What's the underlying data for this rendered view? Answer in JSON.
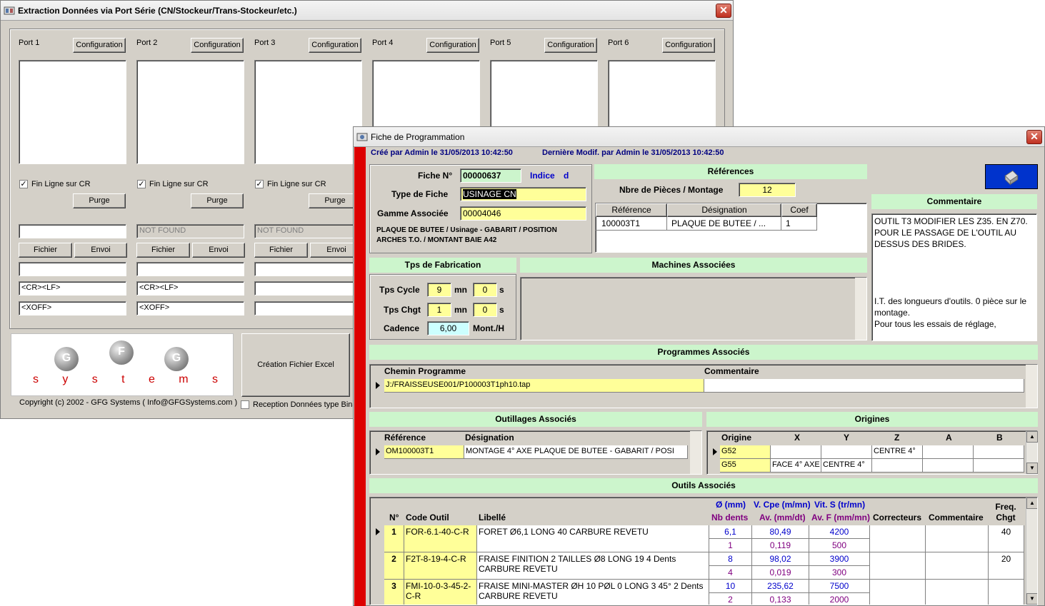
{
  "win1": {
    "title": "Extraction Données via Port Série (CN/Stockeur/Trans-Stockeur/etc.)",
    "close": "✕",
    "ports": [
      {
        "label": "Port 1",
        "config": "Configuration",
        "fin": "Fin Ligne sur CR",
        "purge": "Purge",
        "field1": "",
        "fichier": "Fichier",
        "envoi": "Envoi",
        "field2": "",
        "cr": "<CR><LF>",
        "xoff": "<XOFF>"
      },
      {
        "label": "Port 2",
        "config": "Configuration",
        "fin": "Fin Ligne sur CR",
        "purge": "Purge",
        "field1": "NOT FOUND",
        "fichier": "Fichier",
        "envoi": "Envoi",
        "field2": "",
        "cr": "<CR><LF>",
        "xoff": "<XOFF>"
      },
      {
        "label": "Port 3",
        "config": "Configuration",
        "fin": "Fin Ligne sur CR",
        "purge": "Purge",
        "field1": "NOT FOUND",
        "fichier": "Fichier",
        "envoi": "Envoi",
        "field2": "",
        "cr": "",
        "xoff": ""
      },
      {
        "label": "Port 4",
        "config": "Configuration"
      },
      {
        "label": "Port 5",
        "config": "Configuration"
      },
      {
        "label": "Port 6",
        "config": "Configuration"
      }
    ],
    "logo_letters": [
      "G",
      "F",
      "G"
    ],
    "logo_word": [
      "s",
      "y",
      "s",
      "t",
      "e",
      "m",
      "s"
    ],
    "copyright": "Copyright (c) 2002 - GFG Systems ( Info@GFGSystems.com )",
    "excel_button": "Création Fichier Excel",
    "reception": "Reception Données type Bina"
  },
  "fiche": {
    "title": "Fiche de Programmation",
    "close": "✕",
    "created": "Créé par Admin le 31/05/2013 10:42:50",
    "modified": "Dernière Modif. par Admin le 31/05/2013 10:42:50",
    "fiche_label": "Fiche N°",
    "fiche_value": "00000637",
    "indice_label": "Indice",
    "indice_value": "d",
    "type_label": "Type de Fiche",
    "type_value": "USINAGE CN",
    "gamme_label": "Gamme Associée",
    "gamme_value": "00004046",
    "gamme_desc": "PLAQUE DE BUTEE / Usinage - GABARIT / POSITION ARCHES T.O. / MONTANT BAIE A42",
    "references_title": "Références",
    "nbre_label": "Nbre de Pièces / Montage",
    "nbre_value": "12",
    "ref_headers": [
      "Référence",
      "Désignation",
      "Coef"
    ],
    "ref_row": [
      "100003T1",
      "PLAQUE DE BUTEE / ...",
      "1"
    ],
    "commentaire_title": "Commentaire",
    "commentaire_text1": "OUTIL T3 MODIFIER LES Z35. EN Z70. POUR LE PASSAGE DE L'OUTIL AU DESSUS DES BRIDES.",
    "commentaire_text2": "I.T. des longueurs d'outils. 0 pièce sur le montage.",
    "commentaire_text3": "Pour tous les essais de réglage,",
    "tps_title": "Tps de Fabrication",
    "tps_cycle_label": "Tps Cycle",
    "tps_cycle_mn": "9",
    "tps_cycle_s": "0",
    "tps_chgt_label": "Tps Chgt",
    "tps_chgt_mn": "1",
    "tps_chgt_s": "0",
    "mn": "mn",
    "s": "s",
    "cadence_label": "Cadence",
    "cadence_value": "6,00",
    "cadence_unit": "Mont./H",
    "machines_title": "Machines Associées",
    "programmes_title": "Programmes Associés",
    "prog_headers": [
      "Chemin Programme",
      "Commentaire"
    ],
    "prog_row": [
      "J:/FRAISSEUSE001/P100003T1ph10.tap",
      ""
    ],
    "outillages_title": "Outillages Associés",
    "outil_headers": [
      "Référence",
      "Désignation"
    ],
    "outil_row": [
      "OM100003T1",
      "MONTAGE 4° AXE PLAQUE DE BUTEE - GABARIT / POSI"
    ],
    "origines_title": "Origines",
    "orig_headers": [
      "Origine",
      "X",
      "Y",
      "Z",
      "A",
      "B"
    ],
    "orig_rows": [
      [
        "G52",
        "",
        "",
        "CENTRE 4°",
        "",
        ""
      ],
      [
        "G55",
        "FACE 4° AXE",
        "CENTRE 4°",
        "",
        "",
        ""
      ]
    ],
    "outils_title": "Outils Associés",
    "tool_headers": {
      "n": "N°",
      "code": "Code Outil",
      "lib": "Libellé",
      "diam": "Ø (mm)",
      "nb": "Nb dents",
      "vc": "V. Cpe (m/mn)",
      "av": "Av. (mm/dt)",
      "vs": "Vit. S (tr/mn)",
      "avf": "Av. F (mm/mn)",
      "corr": "Correcteurs",
      "comm": "Commentaire",
      "freq": "Freq. Chgt"
    },
    "tools": [
      {
        "n": "1",
        "code": "FOR-6.1-40-C-R",
        "lib": "FORET Ø6,1 LONG 40 CARBURE REVETU",
        "diam": "6,1",
        "nb": "1",
        "vc": "80,49",
        "av": "0,119",
        "vs": "4200",
        "avf": "500",
        "freq": "40"
      },
      {
        "n": "2",
        "code": "F2T-8-19-4-C-R",
        "lib": "FRAISE FINITION 2 TAILLES Ø8 LONG 19 4 Dents CARBURE REVETU",
        "diam": "8",
        "nb": "4",
        "vc": "98,02",
        "av": "0,019",
        "vs": "3900",
        "avf": "300",
        "freq": "20"
      },
      {
        "n": "3",
        "code": "FMI-10-0-3-45-2-C-R",
        "lib": "FRAISE MINI-MASTER ØH 10 PØL 0 LONG 3 45° 2 Dents CARBURE REVETU",
        "diam": "10",
        "nb": "2",
        "vc": "235,62",
        "av": "0,133",
        "vs": "7500",
        "avf": "2000",
        "freq": ""
      }
    ]
  }
}
